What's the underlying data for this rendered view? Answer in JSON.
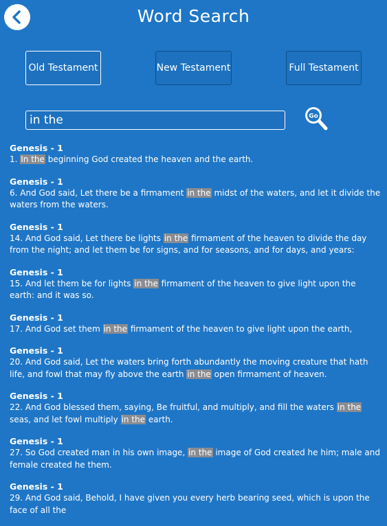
{
  "header": {
    "title": "Word Search",
    "back_icon": "chevron-left-icon"
  },
  "tabs": [
    {
      "label": "Old Testament",
      "active": true
    },
    {
      "label": "New Testament",
      "active": false
    },
    {
      "label": "Full Testament",
      "active": false
    }
  ],
  "search": {
    "value": "in the",
    "go_label": "Go",
    "go_icon": "magnifier-icon"
  },
  "colors": {
    "background": "#1f76c6",
    "highlight": "#8a8c91",
    "text": "#ffffff"
  },
  "results": [
    {
      "ref": "Genesis - 1",
      "before": "1. ",
      "match": "In the",
      "after": " beginning God created the heaven and the earth."
    },
    {
      "ref": "Genesis - 1",
      "before": "6. And God said, Let there be a firmament ",
      "match": "in the",
      "after": " midst of the waters, and let it divide the waters from the waters."
    },
    {
      "ref": "Genesis - 1",
      "before": "14. And God said, Let there be lights ",
      "match": "in the",
      "after": " firmament of the heaven to divide the day from the night; and let them be for signs, and for seasons, and for days, and years:"
    },
    {
      "ref": "Genesis - 1",
      "before": "15. And let them be for lights ",
      "match": "in the",
      "after": " firmament of the heaven to give light upon the earth: and it was so."
    },
    {
      "ref": "Genesis - 1",
      "before": "17. And God set them ",
      "match": "in the",
      "after": " firmament of the heaven to give light upon the earth,"
    },
    {
      "ref": "Genesis - 1",
      "before": "20. And God said, Let the waters bring forth abundantly the moving creature that hath life, and fowl that may fly above the earth ",
      "match": "in the",
      "after": " open firmament of heaven."
    },
    {
      "ref": "Genesis - 1",
      "before": "22. And God blessed them, saying, Be fruitful, and multiply, and fill the waters ",
      "match": "in the",
      "after": " seas, and let fowl multiply ",
      "match2": "in the",
      "after2": " earth."
    },
    {
      "ref": "Genesis - 1",
      "before": "27. So God created man in his own image, ",
      "match": "in the",
      "after": " image of God created he him; male and female created he them."
    },
    {
      "ref": "Genesis - 1",
      "before": "29. And God said, Behold, I have given you every herb bearing seed, which is upon the face of all the",
      "match": "",
      "after": ""
    }
  ]
}
